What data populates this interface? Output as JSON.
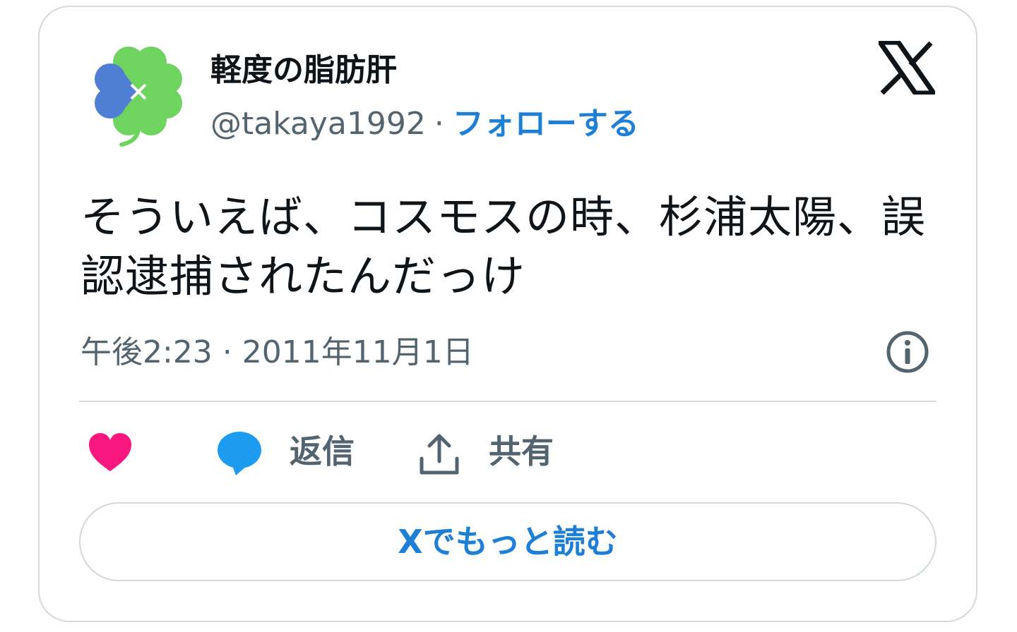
{
  "tweet": {
    "display_name": "軽度の脂肪肝",
    "handle": "@takaya1992",
    "separator": "·",
    "follow_label": "フォローする",
    "text": "そういえば、コスモスの時、杉浦太陽、誤認逮捕されたんだっけ",
    "timestamp": "午後2:23 · 2011年11月1日"
  },
  "actions": {
    "reply_label": "返信",
    "share_label": "共有",
    "read_more_label": "Xでもっと読む"
  },
  "icons": {
    "avatar": "clover-avatar",
    "logo": "x-logo-icon",
    "info": "info-icon",
    "like": "heart-icon",
    "reply": "speech-bubble-icon",
    "share": "upload-share-icon"
  },
  "colors": {
    "accent_blue": "#1d7fd6",
    "heart_pink": "#f91880",
    "reply_blue": "#1d9bf0",
    "clover_green": "#6ed35f",
    "clover_blue": "#4f7fd4",
    "muted_text": "#536471",
    "border": "#cfd9de"
  }
}
